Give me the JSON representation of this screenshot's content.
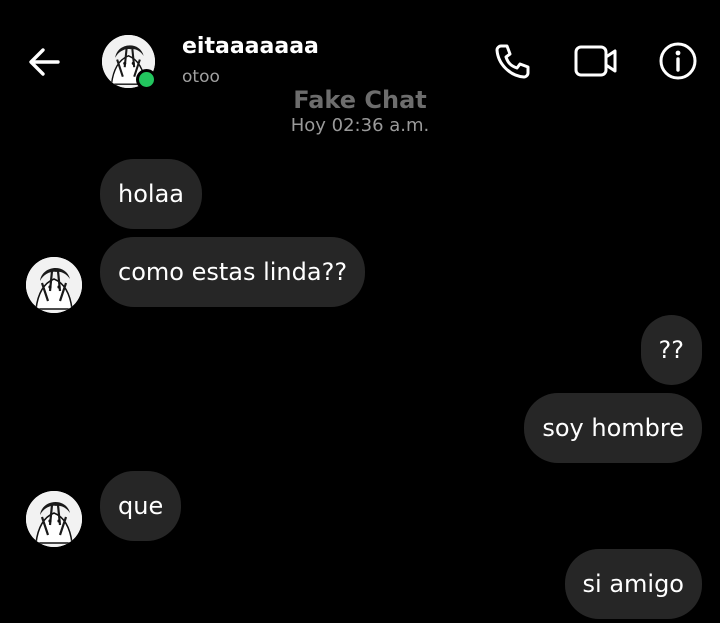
{
  "header": {
    "contact_name": "eitaaaaaaa",
    "contact_status": "otoo",
    "online": true,
    "icons": [
      "back-arrow-icon",
      "phone-icon",
      "video-camera-icon",
      "info-icon"
    ]
  },
  "watermark": {
    "title": "Fake Chat",
    "timestamp": "Hoy 02:36 a.m."
  },
  "messages": [
    {
      "sender": "them",
      "text": "holaa"
    },
    {
      "sender": "them",
      "text": "como estas linda??"
    },
    {
      "sender": "me",
      "text": "??"
    },
    {
      "sender": "me",
      "text": "soy hombre"
    },
    {
      "sender": "them",
      "text": "que"
    },
    {
      "sender": "me",
      "text": "si amigo"
    }
  ],
  "colors": {
    "background": "#000000",
    "bubble": "#262626",
    "online": "#22c55e",
    "status_text": "#a0a0a0"
  }
}
